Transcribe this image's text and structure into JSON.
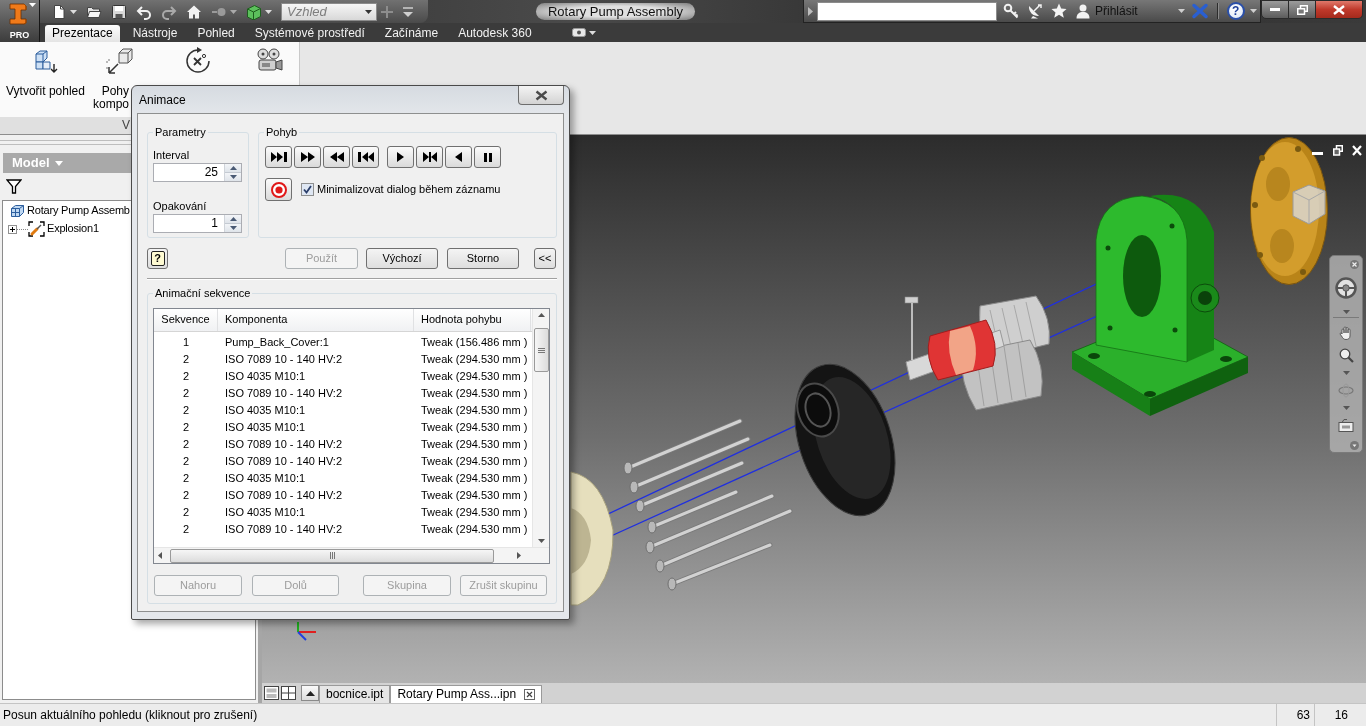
{
  "title_bar": {
    "app_badge": "PRO",
    "appearance": {
      "value": "Vzhled"
    },
    "title": "Rotary Pump Assembly",
    "sign_in": "Přihlásit",
    "help": "?"
  },
  "ribbon": {
    "tabs": [
      {
        "label": "Prezentace",
        "selected": true
      },
      {
        "label": "Nástroje",
        "selected": false
      },
      {
        "label": "Pohled",
        "selected": false
      },
      {
        "label": "Systémové prostředí",
        "selected": false
      },
      {
        "label": "Začínáme",
        "selected": false
      },
      {
        "label": "Autodesk 360",
        "selected": false
      }
    ],
    "buttons": [
      {
        "kind": "create-view",
        "lines": [
          "Vytvořit pohled"
        ]
      },
      {
        "kind": "tweak",
        "lines": [
          "Pohy",
          "kompo"
        ]
      },
      {
        "kind": "rotate"
      },
      {
        "kind": "animate"
      }
    ],
    "panel_label": "V"
  },
  "browser": {
    "title": "Model",
    "tree": [
      {
        "kind": "assembly",
        "label": "Rotary Pump Assemb",
        "children": [
          {
            "kind": "explosion",
            "label": "Explosion1",
            "expanded": false
          }
        ]
      }
    ]
  },
  "document_tabs": [
    {
      "label": "bocnice.ipt",
      "selected": false
    },
    {
      "label": "Rotary Pump Ass...ipn",
      "selected": true
    }
  ],
  "status_bar": {
    "message": "Posun aktuálního pohledu (kliknout pro zrušení)",
    "values": [
      "63",
      "16"
    ]
  },
  "animation_dialog": {
    "title": "Animace",
    "parameters": {
      "title": "Parametry",
      "fields": [
        {
          "label": "Interval",
          "value": "25"
        },
        {
          "label": "Opakování",
          "value": "1"
        }
      ]
    },
    "motion": {
      "title": "Pohyb",
      "control_groups": [
        [
          {
            "kind": "play-to-end"
          },
          {
            "kind": "step-forward"
          },
          {
            "kind": "step-back"
          },
          {
            "kind": "rewind-to-start"
          }
        ],
        [
          {
            "kind": "play"
          },
          {
            "kind": "auto-reverse"
          },
          {
            "kind": "play-reverse"
          },
          {
            "kind": "pause"
          }
        ]
      ],
      "minimize_while_recording": {
        "label": "Minimalizovat dialog během záznamu",
        "checked": true
      }
    },
    "help": "?",
    "buttons": [
      {
        "label": "Použít",
        "disabled": true
      },
      {
        "label": "Výchozí",
        "disabled": false
      },
      {
        "label": "Storno",
        "disabled": false
      },
      {
        "label": "<<",
        "disabled": false
      }
    ],
    "sequence": {
      "title": "Animační sekvence",
      "columns": [
        "Sekvence",
        "Komponenta",
        "Hodnota pohybu"
      ],
      "rows": [
        [
          "1",
          "Pump_Back_Cover:1",
          "Tweak (156.486 mm )"
        ],
        [
          "2",
          "ISO 7089 10 - 140 HV:2",
          "Tweak (294.530 mm )"
        ],
        [
          "2",
          "ISO 4035 M10:1",
          "Tweak (294.530 mm )"
        ],
        [
          "2",
          "ISO 7089 10 - 140 HV:2",
          "Tweak (294.530 mm )"
        ],
        [
          "2",
          "ISO 4035 M10:1",
          "Tweak (294.530 mm )"
        ],
        [
          "2",
          "ISO 4035 M10:1",
          "Tweak (294.530 mm )"
        ],
        [
          "2",
          "ISO 7089 10 - 140 HV:2",
          "Tweak (294.530 mm )"
        ],
        [
          "2",
          "ISO 7089 10 - 140 HV:2",
          "Tweak (294.530 mm )"
        ],
        [
          "2",
          "ISO 4035 M10:1",
          "Tweak (294.530 mm )"
        ],
        [
          "2",
          "ISO 7089 10 - 140 HV:2",
          "Tweak (294.530 mm )"
        ],
        [
          "2",
          "ISO 4035 M10:1",
          "Tweak (294.530 mm )"
        ],
        [
          "2",
          "ISO 7089 10 - 140 HV:2",
          "Tweak (294.530 mm )"
        ]
      ]
    },
    "sequence_buttons": [
      {
        "label": "Nahoru",
        "disabled": true
      },
      {
        "label": "Dolů",
        "disabled": true
      },
      {
        "label": "Skupina",
        "disabled": true
      },
      {
        "label": "Zrušit skupinu",
        "disabled": true
      }
    ]
  }
}
